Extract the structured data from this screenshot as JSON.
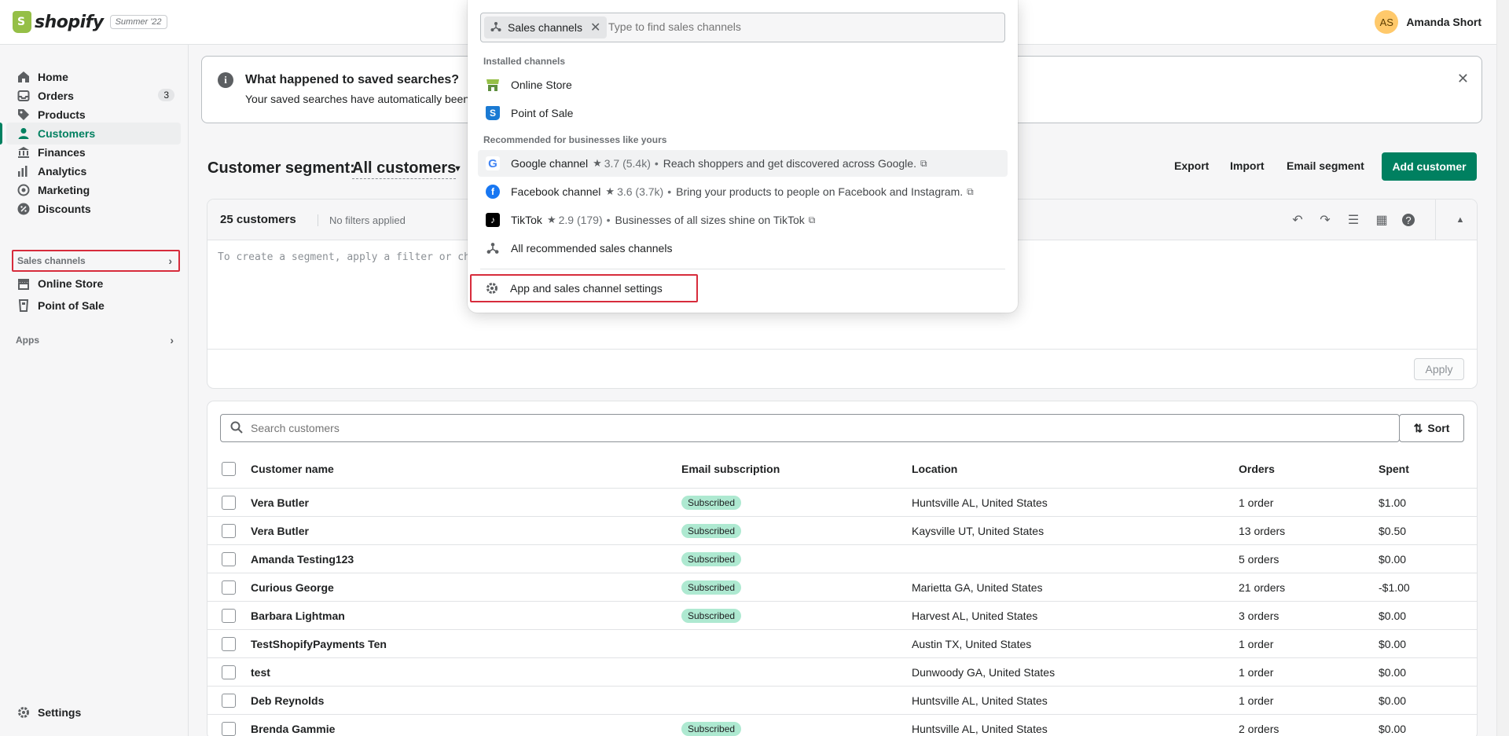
{
  "app": {
    "brand": "shopify",
    "edition": "Summer '22",
    "user_initials": "AS",
    "user_name": "Amanda Short"
  },
  "sidebar": {
    "items": [
      {
        "label": "Home",
        "icon": "home-icon"
      },
      {
        "label": "Orders",
        "icon": "orders-icon",
        "badge": "3"
      },
      {
        "label": "Products",
        "icon": "tag-icon"
      },
      {
        "label": "Customers",
        "icon": "person-icon",
        "active": true
      },
      {
        "label": "Finances",
        "icon": "bank-icon"
      },
      {
        "label": "Analytics",
        "icon": "bar-chart-icon"
      },
      {
        "label": "Marketing",
        "icon": "target-icon"
      },
      {
        "label": "Discounts",
        "icon": "discount-icon"
      }
    ],
    "sales_channels_label": "Sales channels",
    "channels": [
      {
        "label": "Online Store",
        "icon": "store-icon"
      },
      {
        "label": "Point of Sale",
        "icon": "pos-icon"
      }
    ],
    "apps_label": "Apps",
    "settings_label": "Settings"
  },
  "banner": {
    "title": "What happened to saved searches?",
    "body": "Your saved searches have automatically been t"
  },
  "header": {
    "title": "Customer segment:",
    "segment": "All customers",
    "actions": [
      "Export",
      "Import",
      "Email segment"
    ],
    "primary": "Add customer"
  },
  "editor": {
    "count": "25 customers",
    "filters_note": "No filters applied",
    "placeholder": "To create a segment, apply a filter or che",
    "apply": "Apply"
  },
  "list": {
    "search_placeholder": "Search customers",
    "sort_label": "Sort",
    "columns": [
      "Customer name",
      "Email subscription",
      "Location",
      "Orders",
      "Spent"
    ],
    "rows": [
      {
        "name": "Vera Butler",
        "subscription": "Subscribed",
        "location": "Huntsville AL, United States",
        "orders": "1 order",
        "spent": "$1.00"
      },
      {
        "name": "Vera Butler",
        "subscription": "Subscribed",
        "location": "Kaysville UT, United States",
        "orders": "13 orders",
        "spent": "$0.50"
      },
      {
        "name": "Amanda Testing123",
        "subscription": "Subscribed",
        "location": "",
        "orders": "5 orders",
        "spent": "$0.00"
      },
      {
        "name": "Curious George",
        "subscription": "Subscribed",
        "location": "Marietta GA, United States",
        "orders": "21 orders",
        "spent": "-$1.00"
      },
      {
        "name": "Barbara Lightman",
        "subscription": "Subscribed",
        "location": "Harvest AL, United States",
        "orders": "3 orders",
        "spent": "$0.00"
      },
      {
        "name": "TestShopifyPayments Ten",
        "subscription": "",
        "location": "Austin TX, United States",
        "orders": "1 order",
        "spent": "$0.00"
      },
      {
        "name": "test",
        "subscription": "",
        "location": "Dunwoody GA, United States",
        "orders": "1 order",
        "spent": "$0.00"
      },
      {
        "name": "Deb Reynolds",
        "subscription": "",
        "location": "Huntsville AL, United States",
        "orders": "1 order",
        "spent": "$0.00"
      },
      {
        "name": "Brenda Gammie",
        "subscription": "Subscribed",
        "location": "Huntsville AL, United States",
        "orders": "2 orders",
        "spent": "$0.00"
      }
    ]
  },
  "popover": {
    "chip": "Sales channels",
    "search_placeholder": "Type to find sales channels",
    "installed_heading": "Installed channels",
    "installed": [
      {
        "label": "Online Store",
        "icon": "online-store-icon"
      },
      {
        "label": "Point of Sale",
        "icon": "point-of-sale-icon"
      }
    ],
    "recommended_heading": "Recommended for businesses like yours",
    "recommended": [
      {
        "label": "Google channel",
        "rating": "3.7 (5.4k)",
        "desc": "Reach shoppers and get discovered across Google.",
        "icon": "google-icon"
      },
      {
        "label": "Facebook channel",
        "rating": "3.6 (3.7k)",
        "desc": "Bring your products to people on Facebook and Instagram.",
        "icon": "facebook-icon"
      },
      {
        "label": "TikTok",
        "rating": "2.9 (179)",
        "desc": "Businesses of all sizes shine on TikTok",
        "icon": "tiktok-icon"
      }
    ],
    "all_recommended": "All recommended sales channels",
    "settings": "App and sales channel settings"
  },
  "colors": {
    "accent": "#008060",
    "highlight": "#d72c3c",
    "subscribed_pill": "#aee9d1"
  }
}
